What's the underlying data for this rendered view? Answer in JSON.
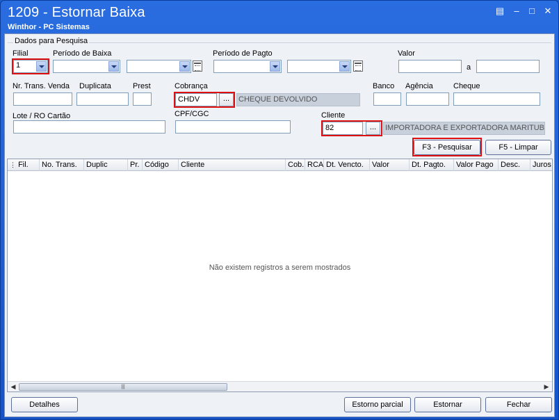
{
  "window": {
    "title": "1209 - Estornar Baixa",
    "subtitle": "Winthor - PC Sistemas"
  },
  "filters": {
    "group_title": "Dados para Pesquisa",
    "filial": {
      "label": "Filial",
      "value": "1"
    },
    "periodo_baixa": {
      "label": "Período de Baixa",
      "from": "",
      "to": ""
    },
    "periodo_pagto": {
      "label": "Período de Pagto",
      "from": "",
      "to": ""
    },
    "valor": {
      "label": "Valor",
      "from": "",
      "separator": "a",
      "to": ""
    },
    "nr_trans_venda": {
      "label": "Nr. Trans. Venda",
      "value": ""
    },
    "duplicata": {
      "label": "Duplicata",
      "value": ""
    },
    "prest": {
      "label": "Prest",
      "value": ""
    },
    "cobranca": {
      "label": "Cobrança",
      "code": "CHDV",
      "description": "CHEQUE DEVOLVIDO"
    },
    "banco": {
      "label": "Banco",
      "value": ""
    },
    "agencia": {
      "label": "Agência",
      "value": ""
    },
    "cheque": {
      "label": "Cheque",
      "value": ""
    },
    "lote": {
      "label": "Lote / RO Cartão",
      "value": ""
    },
    "cpf": {
      "label": "CPF/CGC",
      "value": ""
    },
    "cliente": {
      "label": "Cliente",
      "code": "82",
      "description": "IMPORTADORA E EXPORTADORA MARITUBA LT"
    },
    "ellipsis": "..."
  },
  "actions": {
    "pesquisar": "F3 - Pesquisar",
    "limpar": "F5 - Limpar"
  },
  "grid": {
    "columns": [
      "Fil.",
      "No. Trans.",
      "Duplic",
      "Pr.",
      "Código",
      "Cliente",
      "Cob.",
      "RCA",
      "Dt. Vencto.",
      "Valor",
      "Dt. Pagto.",
      "Valor Pago",
      "Desc.",
      "Juros"
    ],
    "empty_message": "Não existem registros a serem mostrados"
  },
  "footer": {
    "detalhes": "Detalhes",
    "estorno_parcial": "Estorno parcial",
    "estornar": "Estornar",
    "fechar": "Fechar"
  },
  "colors": {
    "titlebar": "#1553c8",
    "highlight": "#e01010",
    "client_bg": "#eef1f6"
  }
}
